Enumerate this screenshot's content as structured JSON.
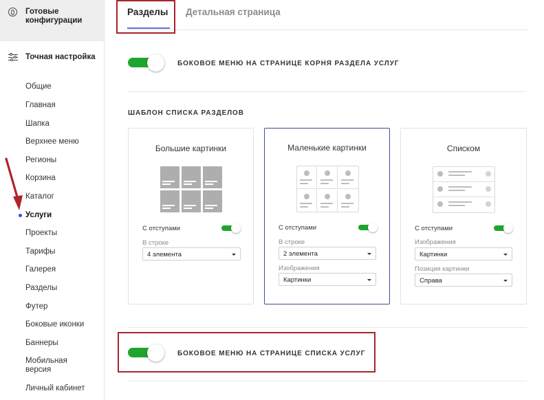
{
  "sidebar": {
    "top_item": "Готовые конфигурации",
    "section": "Точная настройка",
    "items": [
      "Общие",
      "Главная",
      "Шапка",
      "Верхнее меню",
      "Регионы",
      "Корзина",
      "Каталог",
      "Услуги",
      "Проекты",
      "Тарифы",
      "Галерея",
      "Разделы",
      "Футер",
      "Боковые иконки",
      "Баннеры",
      "Мобильная версия",
      "Личный кабинет"
    ],
    "active_item": "Услуги"
  },
  "tabs": [
    "Разделы",
    "Детальная страница"
  ],
  "toggle_root": {
    "label": "БОКОВОЕ МЕНЮ НА СТРАНИЦЕ КОРНЯ РАЗДЕЛА УСЛУГ",
    "on": true
  },
  "template_section": {
    "title": "ШАБЛОН СПИСКА РАЗДЕЛОВ",
    "cards": [
      {
        "title": "Большие картинки",
        "option_label": "С отступами",
        "fields": [
          {
            "label": "В строке",
            "value": "4 элемента"
          }
        ]
      },
      {
        "title": "Маленькие картинки",
        "option_label": "С отступами",
        "fields": [
          {
            "label": "В строке",
            "value": "2 элемента"
          },
          {
            "label": "Изображения",
            "value": "Картинки"
          }
        ]
      },
      {
        "title": "Списком",
        "option_label": "С отступами",
        "fields": [
          {
            "label": "Изображения",
            "value": "Картинки"
          },
          {
            "label": "Позиция картинки",
            "value": "Справа"
          }
        ]
      }
    ],
    "selected_card": "Маленькие картинки"
  },
  "toggle_list": {
    "label": "БОКОВОЕ МЕНЮ НА СТРАНИЦЕ СПИСКА УСЛУГ",
    "on": true
  },
  "colors": {
    "toggle_on": "#1fa52d",
    "highlight": "#a8232a",
    "accent": "#5b6fd6",
    "selected_border": "#3d4c99"
  }
}
